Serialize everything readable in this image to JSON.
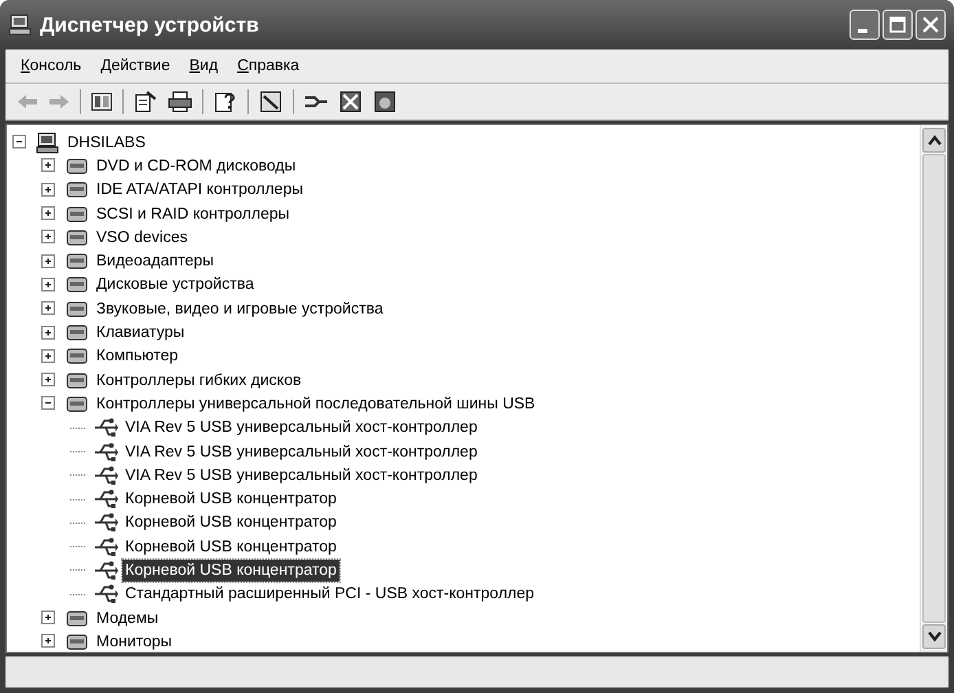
{
  "window": {
    "title": "Диспетчер устройств"
  },
  "menu": [
    "Консоль",
    "Действие",
    "Вид",
    "Справка"
  ],
  "tree": [
    {
      "label": "DHSILABS",
      "expanded": true,
      "selected": false,
      "children": [
        {
          "label": "DVD и CD-ROM дисководы",
          "expanded": false,
          "selected": false
        },
        {
          "label": "IDE ATA/ATAPI контроллеры",
          "expanded": false,
          "selected": false
        },
        {
          "label": "SCSI и RAID контроллеры",
          "expanded": false,
          "selected": false
        },
        {
          "label": "VSO devices",
          "expanded": false,
          "selected": false
        },
        {
          "label": "Видеоадаптеры",
          "expanded": false,
          "selected": false
        },
        {
          "label": "Дисковые устройства",
          "expanded": false,
          "selected": false
        },
        {
          "label": "Звуковые, видео и игровые устройства",
          "expanded": false,
          "selected": false
        },
        {
          "label": "Клавиатуры",
          "expanded": false,
          "selected": false
        },
        {
          "label": "Компьютер",
          "expanded": false,
          "selected": false
        },
        {
          "label": "Контроллеры гибких дисков",
          "expanded": false,
          "selected": false
        },
        {
          "label": "Контроллеры универсальной последовательной шины USB",
          "expanded": true,
          "selected": false,
          "children": [
            {
              "label": "VIA Rev 5 USB универсальный хост-контроллер",
              "selected": false
            },
            {
              "label": "VIA Rev 5 USB универсальный хост-контроллер",
              "selected": false
            },
            {
              "label": "VIA Rev 5 USB универсальный хост-контроллер",
              "selected": false
            },
            {
              "label": "Корневой USB концентратор",
              "selected": false
            },
            {
              "label": "Корневой USB концентратор",
              "selected": false
            },
            {
              "label": "Корневой USB концентратор",
              "selected": false
            },
            {
              "label": "Корневой USB концентратор",
              "selected": true
            },
            {
              "label": "Стандартный расширенный PCI - USB хост-контроллер",
              "selected": false
            }
          ]
        },
        {
          "label": "Модемы",
          "expanded": false,
          "selected": false
        },
        {
          "label": "Мониторы",
          "expanded": false,
          "selected": false
        }
      ]
    }
  ]
}
